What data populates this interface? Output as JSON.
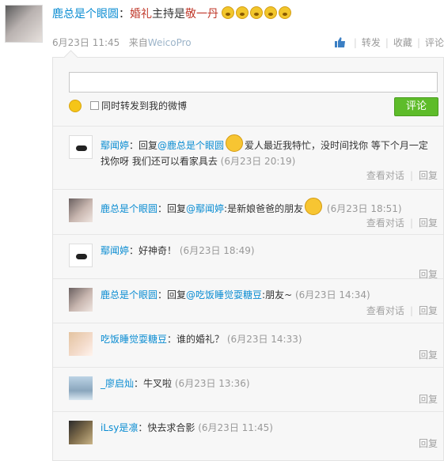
{
  "post": {
    "author": "鹿总是个眼圆",
    "colon": "：",
    "text_red1": "婚礼",
    "text_mid": "主持是",
    "text_red2": "敬一丹",
    "emoticon_icon": "shocked-face-icon",
    "timestamp": "6月23日 11:45",
    "source_prefix": "来自",
    "source_app": "WeicoPro",
    "actions": {
      "like": "like-thumb-icon",
      "forward": "转发",
      "favorite": "收藏",
      "comment": "评论"
    }
  },
  "composer": {
    "input_value": "",
    "checkbox_label": "同时转发到我的微博",
    "submit_label": "评论"
  },
  "comments": [
    {
      "name": "鄢闻婷",
      "pre": "：回复",
      "mention": "@鹿总是个眼圆",
      "text": "爱人最近我特忙，没时间找你 等下个月一定找你呀 我们还可以看家具去",
      "time": "(6月23日 20:19)",
      "view": "查看对话",
      "reply": "回复",
      "avatar": "cat"
    },
    {
      "name": "鹿总是个眼圆",
      "pre": "：回复",
      "mention": "@鄢闻婷",
      "text": ":是新娘爸爸的朋友",
      "time": "(6月23日 18:51)",
      "view": "查看对话",
      "reply": "回复",
      "avatar": "girl"
    },
    {
      "name": "鄢闻婷",
      "pre": "：",
      "mention": "",
      "text": "好神奇！",
      "time": "(6月23日 18:49)",
      "view": "",
      "reply": "回复",
      "avatar": "cat"
    },
    {
      "name": "鹿总是个眼圆",
      "pre": "：回复",
      "mention": "@吃饭睡觉耍糖豆",
      "text": ":朋友~",
      "time": "(6月23日 14:34)",
      "view": "查看对话",
      "reply": "回复",
      "avatar": "girl"
    },
    {
      "name": "吃饭睡觉耍糖豆",
      "pre": "：",
      "mention": "",
      "text": "谁的婚礼？",
      "time": "(6月23日 14:33)",
      "view": "",
      "reply": "回复",
      "avatar": "girl2"
    },
    {
      "name": "_廖启灿",
      "pre": "：",
      "mention": "",
      "text": "牛叉啦",
      "time": "(6月23日 13:36)",
      "view": "",
      "reply": "回复",
      "avatar": "water"
    },
    {
      "name": "iLsy是凛",
      "pre": "：",
      "mention": "",
      "text": "快去求合影",
      "time": "(6月23日 11:45)",
      "view": "",
      "reply": "回复",
      "avatar": "man"
    }
  ]
}
